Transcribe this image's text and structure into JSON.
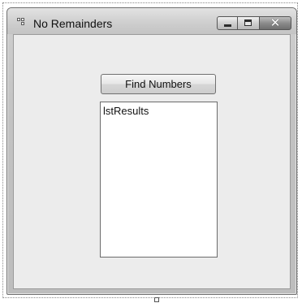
{
  "window": {
    "title": "No Remainders",
    "icon": "form-icon",
    "caption_buttons": {
      "minimize_icon": "minimize-icon",
      "maximize_icon": "maximize-icon",
      "close_icon": "close-icon",
      "close_glyph": "✕"
    }
  },
  "form": {
    "find_button_label": "Find Numbers",
    "listbox_name": "lstResults"
  }
}
